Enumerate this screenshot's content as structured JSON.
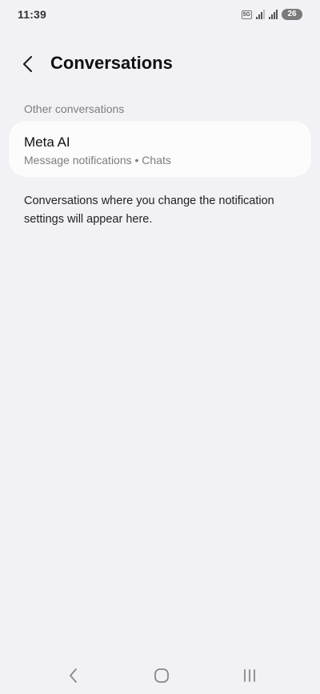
{
  "status_bar": {
    "time": "11:39",
    "network_label": "5G",
    "battery_level": "26"
  },
  "header": {
    "title": "Conversations",
    "back_icon": "chevron-left-icon"
  },
  "section": {
    "label": "Other conversations"
  },
  "conversation": {
    "name": "Meta AI",
    "subtitle": "Message notifications • Chats"
  },
  "info": {
    "text": "Conversations where you change the notification settings will appear here."
  },
  "nav_bar": {
    "icons": [
      "back-icon",
      "home-icon",
      "recents-icon"
    ]
  },
  "colors": {
    "background": "#f2f2f6",
    "card": "#fcfcfd",
    "secondary_text": "#7d7d82"
  }
}
